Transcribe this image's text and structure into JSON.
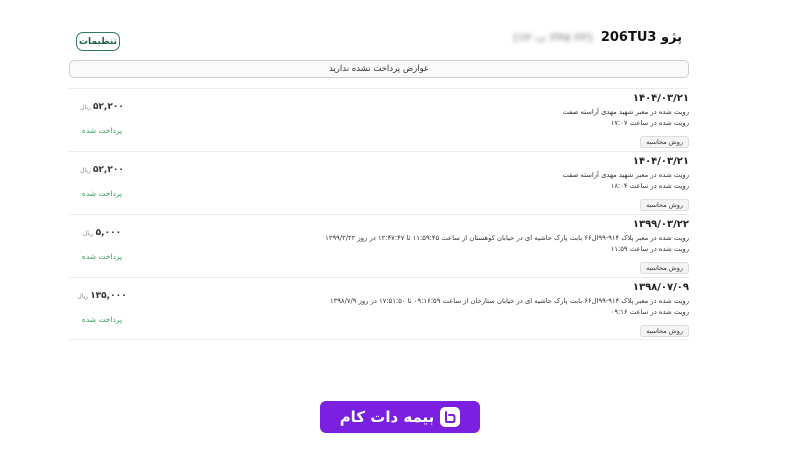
{
  "header": {
    "settings_label": "تنظیمات",
    "car_title": "پژو 206TU3",
    "plate_blurred": "(۲۲ ۳۴۵ ب ۱۲)"
  },
  "notice": {
    "text": "عوارض پرداخت نشده ندارید"
  },
  "records": [
    {
      "date": "۱۴۰۴/۰۳/۲۱",
      "lines": [
        "رویت شده در معبر شهید مهدی آراسته صفت",
        "رویت شده در ساعت ۱۷:۰۷"
      ],
      "method": "روش محاسبه",
      "amount": "۵۲,۲۰۰",
      "currency": "ریال",
      "status": "پرداخت شده"
    },
    {
      "date": "۱۴۰۴/۰۳/۲۱",
      "lines": [
        "رویت شده در معبر شهید مهدی آراسته صفت",
        "رویت شده در ساعت ۱۸:۰۴"
      ],
      "method": "روش محاسبه",
      "amount": "۵۲,۲۰۰",
      "currency": "ریال",
      "status": "پرداخت شده"
    },
    {
      "date": "۱۳۹۹/۰۳/۲۲",
      "lines": [
        "رویت شده در معبر پلاک ۹۱۴-۹۹ال۶۶ بابت پارک حاشیه ای در خیابان کوهستان از ساعت ۱۱:۵۹:۴۵ تا ۱۲:۴۷:۴۷ در روز ۱۳۹۹/۳/۲۲",
        "رویت شده در ساعت ۱۱:۵۹"
      ],
      "method": "روش محاسبه",
      "amount": "۵,۰۰۰",
      "currency": "ریال",
      "status": "پرداخت شده"
    },
    {
      "date": "۱۳۹۸/۰۷/۰۹",
      "lines": [
        "رویت شده در معبر پلاک ۹۱۴-۹۹ال۶۶ بابت پارک حاشیه ای در خیابان ستارخان از ساعت ۰۹:۱۶:۵۹ تا ۱۷:۵۱:۵۰ در روز ۱۳۹۸/۷/۹",
        "رویت شده در ساعت ۰۹:۱۶"
      ],
      "method": "روش محاسبه",
      "amount": "۱۳۵,۰۰۰",
      "currency": "ریال",
      "status": "پرداخت شده"
    }
  ],
  "brand": {
    "logo_text": "بیمه دات کام",
    "color": "#7b1fe0",
    "status_color": "#3aa35a"
  }
}
